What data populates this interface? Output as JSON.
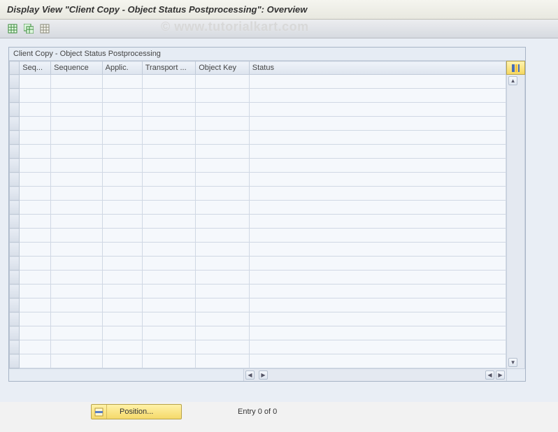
{
  "header": {
    "title": "Display View \"Client Copy - Object Status Postprocessing\": Overview"
  },
  "toolbar": {
    "buttons": [
      {
        "name": "display-change-button",
        "icon": "table-green-icon"
      },
      {
        "name": "copy-button",
        "icon": "table-copy-icon"
      },
      {
        "name": "delimit-button",
        "icon": "table-plain-icon"
      }
    ]
  },
  "table": {
    "title": "Client Copy - Object Status Postprocessing",
    "columns": [
      {
        "key": "seq_dots",
        "label": "Seq..."
      },
      {
        "key": "sequence",
        "label": "Sequence"
      },
      {
        "key": "applic",
        "label": "Applic."
      },
      {
        "key": "transport",
        "label": "Transport ..."
      },
      {
        "key": "object_key",
        "label": "Object Key"
      },
      {
        "key": "status",
        "label": "Status"
      }
    ],
    "rows": [],
    "visible_empty_rows": 21
  },
  "footer": {
    "position_label": "Position...",
    "entry_text": "Entry 0 of 0"
  },
  "watermark": "© www.tutorialkart.com"
}
